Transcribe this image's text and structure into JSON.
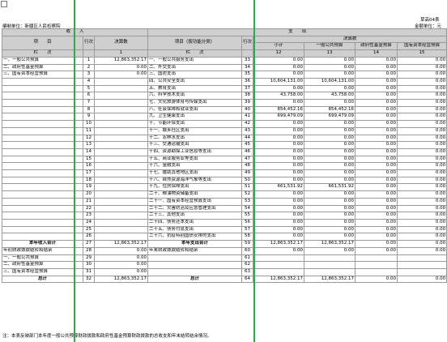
{
  "header": {
    "form_no": "草高04表",
    "unit": "编制单位：新疆区人民检察院",
    "currency": "金额单位：元"
  },
  "table": {
    "income_title": "收　　入",
    "expense_title": "支　　出",
    "col_item": "项　　目",
    "col_line": "行次",
    "col_final": "决算数",
    "col_exp_item": "项目（按功能分类）",
    "col_exp_line": "行次",
    "col_exp_final": "决算数",
    "col_subtotal": "小计",
    "col_public": "一般公共预算",
    "col_fund": "政府性基金预算",
    "col_state": "国有资本经营预算",
    "colnum_label": "栏　　次",
    "colnum_1": "1",
    "colnum_2": "3",
    "colnum_3": "12",
    "colnum_4": "13",
    "colnum_5": "14",
    "colnum_6": "15"
  },
  "rows": [
    {
      "in_item": "一、一般公共预算",
      "in_line": "1",
      "in_val": "12,863,352.17",
      "ex_item": "一、一般公共服务支出",
      "ex_line": "33",
      "sub": "0.00",
      "pub": "0.00",
      "fund": "0.00",
      "state": "0.00"
    },
    {
      "in_item": "二、政府性基金预算",
      "in_line": "2",
      "in_val": "0.00",
      "ex_item": "二、外交支出",
      "ex_line": "34",
      "sub": "0.00",
      "pub": "0.00",
      "fund": "0.00",
      "state": "0.00"
    },
    {
      "in_item": "三、国有资本经营预算",
      "in_line": "3",
      "in_val": "0.00",
      "ex_item": "三、国防支出",
      "ex_line": "35",
      "sub": "0.00",
      "pub": "0.00",
      "fund": "0.00",
      "state": "0.00"
    },
    {
      "in_item": "",
      "in_line": "4",
      "in_val": "",
      "ex_item": "四、公共安全支出",
      "ex_line": "36",
      "sub": "10,604,131.00",
      "pub": "10,604,131.00",
      "fund": "0.00",
      "state": "0.00"
    },
    {
      "in_item": "",
      "in_line": "5",
      "in_val": "",
      "ex_item": "五、教育支出",
      "ex_line": "37",
      "sub": "0.00",
      "pub": "0.00",
      "fund": "0.00",
      "state": "0.00"
    },
    {
      "in_item": "",
      "in_line": "6",
      "in_val": "",
      "ex_item": "六、科学技术支出",
      "ex_line": "38",
      "sub": "43,758.00",
      "pub": "43,758.00",
      "fund": "0.00",
      "state": "0.00"
    },
    {
      "in_item": "",
      "in_line": "7",
      "in_val": "",
      "ex_item": "七、文化旅游体育与传媒支出",
      "ex_line": "39",
      "sub": "0.00",
      "pub": "0.00",
      "fund": "0.00",
      "state": "0.00"
    },
    {
      "in_item": "",
      "in_line": "8",
      "in_val": "",
      "ex_item": "八、社会保障和就业支出",
      "ex_line": "40",
      "sub": "854,452.16",
      "pub": "854,452.16",
      "fund": "0.00",
      "state": "0.00"
    },
    {
      "in_item": "",
      "in_line": "9",
      "in_val": "",
      "ex_item": "九、卫生健康支出",
      "ex_line": "41",
      "sub": "699,479.09",
      "pub": "699,479.09",
      "fund": "0.00",
      "state": "0.00"
    },
    {
      "in_item": "",
      "in_line": "10",
      "in_val": "",
      "ex_item": "十、节能环保支出",
      "ex_line": "42",
      "sub": "0.00",
      "pub": "0.00",
      "fund": "0.00",
      "state": "0.00"
    },
    {
      "in_item": "",
      "in_line": "11",
      "in_val": "",
      "ex_item": "十一、城乡社区支出",
      "ex_line": "43",
      "sub": "0.00",
      "pub": "0.00",
      "fund": "0.00",
      "state": "0.00"
    },
    {
      "in_item": "",
      "in_line": "12",
      "in_val": "",
      "ex_item": "十二、农林水支出",
      "ex_line": "44",
      "sub": "0.00",
      "pub": "0.00",
      "fund": "0.00",
      "state": "0.00"
    },
    {
      "in_item": "",
      "in_line": "13",
      "in_val": "",
      "ex_item": "十三、交通运输支出",
      "ex_line": "45",
      "sub": "0.00",
      "pub": "0.00",
      "fund": "0.00",
      "state": "0.00"
    },
    {
      "in_item": "",
      "in_line": "14",
      "in_val": "",
      "ex_item": "十四、资源勘探工业信息等支出",
      "ex_line": "46",
      "sub": "0.00",
      "pub": "0.00",
      "fund": "0.00",
      "state": "0.00"
    },
    {
      "in_item": "",
      "in_line": "15",
      "in_val": "",
      "ex_item": "十五、商业服务业等支出",
      "ex_line": "47",
      "sub": "0.00",
      "pub": "0.00",
      "fund": "0.00",
      "state": "0.00"
    },
    {
      "in_item": "",
      "in_line": "16",
      "in_val": "",
      "ex_item": "十六、金融支出",
      "ex_line": "48",
      "sub": "0.00",
      "pub": "0.00",
      "fund": "0.00",
      "state": "0.00"
    },
    {
      "in_item": "",
      "in_line": "17",
      "in_val": "",
      "ex_item": "十七、援助其他地区支出",
      "ex_line": "49",
      "sub": "0.00",
      "pub": "0.00",
      "fund": "0.00",
      "state": "0.00"
    },
    {
      "in_item": "",
      "in_line": "18",
      "in_val": "",
      "ex_item": "十八、自然资源海洋气象等支出",
      "ex_line": "50",
      "sub": "0.00",
      "pub": "0.00",
      "fund": "0.00",
      "state": "0.00"
    },
    {
      "in_item": "",
      "in_line": "19",
      "in_val": "",
      "ex_item": "十九、住房保障支出",
      "ex_line": "51",
      "sub": "661,531.92",
      "pub": "661,531.92",
      "fund": "0.00",
      "state": "0.00"
    },
    {
      "in_item": "",
      "in_line": "20",
      "in_val": "",
      "ex_item": "二十、粮油物资储备支出",
      "ex_line": "52",
      "sub": "0.00",
      "pub": "0.00",
      "fund": "0.00",
      "state": "0.00"
    },
    {
      "in_item": "",
      "in_line": "21",
      "in_val": "",
      "ex_item": "二十一、国有资本经营预算支出",
      "ex_line": "53",
      "sub": "0.00",
      "pub": "0.00",
      "fund": "0.00",
      "state": "0.00"
    },
    {
      "in_item": "",
      "in_line": "22",
      "in_val": "",
      "ex_item": "二十二、灾害防治及应急管理支出",
      "ex_line": "54",
      "sub": "0.00",
      "pub": "0.00",
      "fund": "0.00",
      "state": "0.00"
    },
    {
      "in_item": "",
      "in_line": "23",
      "in_val": "",
      "ex_item": "二十三、其他支出",
      "ex_line": "55",
      "sub": "0.00",
      "pub": "0.00",
      "fund": "0.00",
      "state": "0.00"
    },
    {
      "in_item": "",
      "in_line": "24",
      "in_val": "",
      "ex_item": "二十四、债务还本支出",
      "ex_line": "56",
      "sub": "0.00",
      "pub": "0.00",
      "fund": "0.00",
      "state": "0.00"
    },
    {
      "in_item": "",
      "in_line": "25",
      "in_val": "",
      "ex_item": "二十五、债务付息支出",
      "ex_line": "57",
      "sub": "0.00",
      "pub": "0.00",
      "fund": "0.00",
      "state": "0.00"
    },
    {
      "in_item": "",
      "in_line": "26",
      "in_val": "",
      "ex_item": "二十六、抗疫特别国债安排的支出",
      "ex_line": "58",
      "sub": "0.00",
      "pub": "0.00",
      "fund": "0.00",
      "state": "0.00"
    }
  ],
  "totals": {
    "income_total_label": "本年收入合计",
    "income_total_line": "27",
    "income_total_val": "12,863,352.17",
    "expense_total_label": "本年支出合计",
    "expense_total_line": "59",
    "expense_total_sub": "12,863,352.17",
    "expense_total_pub": "12,863,352.17",
    "expense_total_fund": "0.00",
    "expense_total_state": "0.00"
  },
  "carry_rows": [
    {
      "in_item": "年初财政拨款结转和结余",
      "in_line": "28",
      "in_val": "0.00",
      "ex_item": "年末财政拨款结转和结余",
      "ex_line": "60",
      "sub": "0.00",
      "pub": "0.00",
      "fund": "0.00",
      "state": "0.00"
    },
    {
      "in_item": "一、一般公共预算",
      "in_line": "29",
      "in_val": "0.00",
      "ex_item": "",
      "ex_line": "61",
      "sub": "",
      "pub": "",
      "fund": "",
      "state": ""
    },
    {
      "in_item": "二、政府性基金预算",
      "in_line": "30",
      "in_val": "0.00",
      "ex_item": "",
      "ex_line": "62",
      "sub": "",
      "pub": "",
      "fund": "",
      "state": ""
    },
    {
      "in_item": "三、国有资本经营预算",
      "in_line": "31",
      "in_val": "0.00",
      "ex_item": "",
      "ex_line": "63",
      "sub": "",
      "pub": "",
      "fund": "",
      "state": ""
    }
  ],
  "grand": {
    "label_in": "总计",
    "line_in": "32",
    "val_in": "12,863,352.17",
    "label_ex": "总计",
    "line_ex": "64",
    "sub": "12,863,352.17",
    "pub": "12,863,352.17",
    "fund": "0.00",
    "state": "0.00"
  },
  "note": "注：本表反映部门本年度一般公共预算财政拨款和政府性基金预算财政拨款的总收支和年末结转结余情况。",
  "colors": {
    "header_fill": "#cfcfcf",
    "grid": "#9a9a9a",
    "guide_line": "#2eaa4a"
  }
}
